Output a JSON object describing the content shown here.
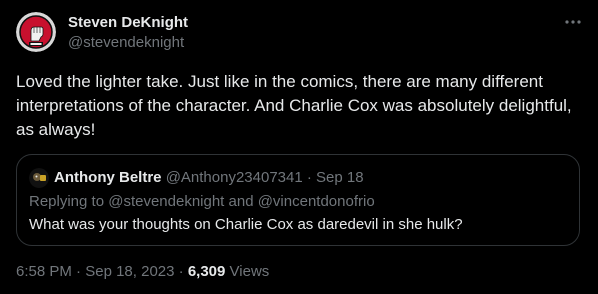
{
  "author": {
    "name": "Steven DeKnight",
    "handle": "@stevendeknight",
    "avatar_icon": "unity-fist-avatar-icon"
  },
  "more_icon": "more-horizontal-icon",
  "tweet_text": "Loved the lighter take. Just like in the comics, there are many different interpretations of the character. And Charlie Cox was absolutely delightful, as always!",
  "quote": {
    "avatar_icon": "quoted-user-avatar-icon",
    "name": "Anthony Beltre",
    "handle": "@Anthony23407341",
    "separator": "·",
    "date": "Sep 18",
    "replying_to": "Replying to @stevendeknight and @vincentdonofrio",
    "text": "What was your thoughts on Charlie Cox as daredevil in she hulk?"
  },
  "meta": {
    "time": "6:58 PM",
    "separator": "·",
    "date": "Sep 18, 2023",
    "views_count": "6,309",
    "views_label": "Views"
  },
  "colors": {
    "background": "#000000",
    "primary_text": "#e7e9ea",
    "secondary_text": "#71767b",
    "border": "#2f3336"
  }
}
